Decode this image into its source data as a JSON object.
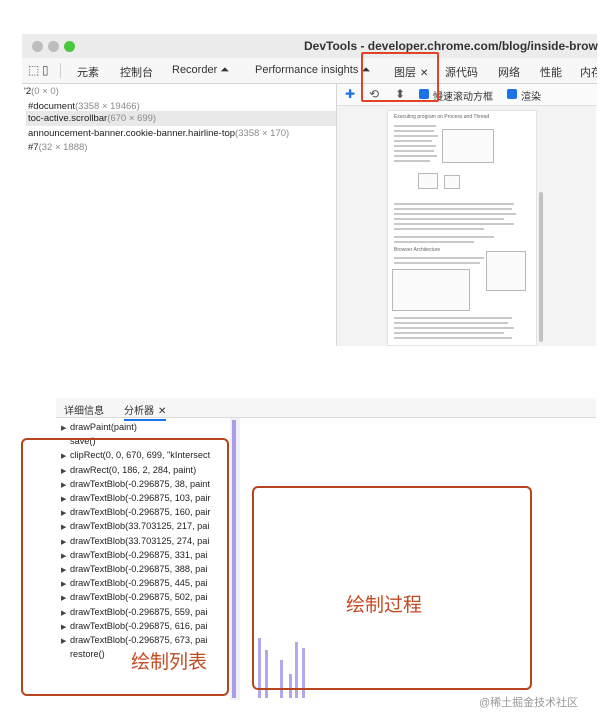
{
  "window": {
    "title": "DevTools - developer.chrome.com/blog/inside-brow"
  },
  "tabs": [
    {
      "label": "元素"
    },
    {
      "label": "控制台"
    },
    {
      "label": "Recorder ⏶"
    },
    {
      "label": "Performance insights ⏶"
    },
    {
      "label": "图层"
    },
    {
      "label": "源代码"
    },
    {
      "label": "网络"
    },
    {
      "label": "性能"
    },
    {
      "label": "内存"
    }
  ],
  "layers": {
    "rows": [
      {
        "name": "'2",
        "size": "(0 × 0)"
      },
      {
        "name": "#document",
        "size": "(3358 × 19466)"
      },
      {
        "name": "toc-active.scrollbar",
        "size": "(670 × 699)"
      },
      {
        "name": "announcement-banner.cookie-banner.hairline-top",
        "size": "(3358 × 170)"
      },
      {
        "name": "#7",
        "size": "(32 × 1888)"
      }
    ]
  },
  "layer_toolbar": {
    "slow_scroll_label": "慢速滚动方框",
    "paint_label": "渲染"
  },
  "preview": {
    "heading": "Executing program on Process and Thread",
    "heading2": "Browser Architecture"
  },
  "bottom_tabs": {
    "details": "详细信息",
    "profiler": "分析器"
  },
  "commands": [
    {
      "text": "drawPaint(paint)",
      "expandable": true
    },
    {
      "text": "save()",
      "expandable": false
    },
    {
      "text": "clipRect(0, 0, 670, 699, \"kIntersect",
      "expandable": true
    },
    {
      "text": "drawRect(0, 186, 2, 284, paint)",
      "expandable": true
    },
    {
      "text": "drawTextBlob(-0.296875, 38, paint",
      "expandable": true
    },
    {
      "text": "drawTextBlob(-0.296875, 103, pair",
      "expandable": true
    },
    {
      "text": "drawTextBlob(-0.296875, 160, pair",
      "expandable": true
    },
    {
      "text": "drawTextBlob(33.703125, 217, pai",
      "expandable": true
    },
    {
      "text": "drawTextBlob(33.703125, 274, pai",
      "expandable": true
    },
    {
      "text": "drawTextBlob(-0.296875, 331, pai",
      "expandable": true
    },
    {
      "text": "drawTextBlob(-0.296875, 388, pai",
      "expandable": true
    },
    {
      "text": "drawTextBlob(-0.296875, 445, pai",
      "expandable": true
    },
    {
      "text": "drawTextBlob(-0.296875, 502, pai",
      "expandable": true
    },
    {
      "text": "drawTextBlob(-0.296875, 559, pai",
      "expandable": true
    },
    {
      "text": "drawTextBlob(-0.296875, 616, pai",
      "expandable": true
    },
    {
      "text": "drawTextBlob(-0.296875, 673, pai",
      "expandable": true
    },
    {
      "text": "restore()",
      "expandable": false
    }
  ],
  "annotations": {
    "paint_process": "绘制过程",
    "paint_list": "绘制列表"
  },
  "watermark": "@稀土掘金技术社区",
  "colors": {
    "accent": "#1a73e8",
    "annotation": "#c44a22",
    "timeline_bars": "#b3a8ee"
  }
}
